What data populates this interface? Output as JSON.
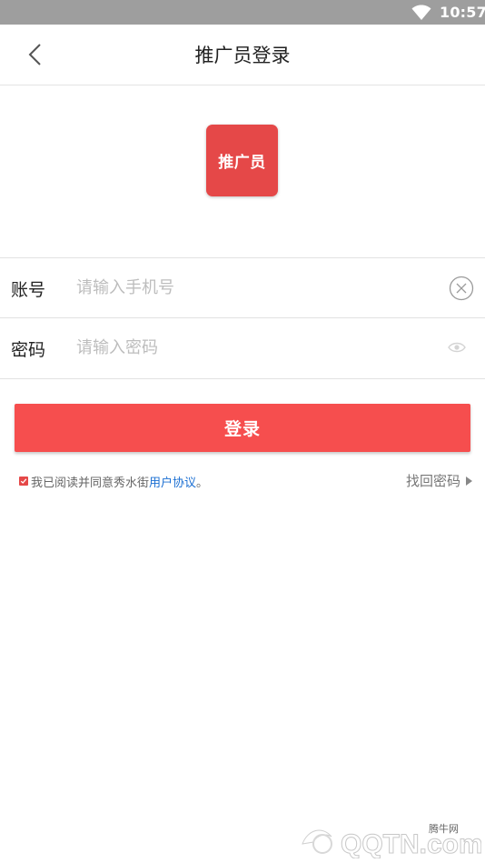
{
  "status_bar": {
    "time": "10:57"
  },
  "header": {
    "title": "推广员登录"
  },
  "logo": {
    "label": "推广员",
    "color": "#e54848"
  },
  "form": {
    "account": {
      "label": "账号",
      "placeholder": "请输入手机号",
      "value": ""
    },
    "password": {
      "label": "密码",
      "placeholder": "请输入密码",
      "value": ""
    }
  },
  "login_button": {
    "label": "登录",
    "color": "#f64e4e"
  },
  "agreement": {
    "text": "我已阅读并同意秀水街",
    "link": "用户协议",
    "suffix": "。",
    "checked": true,
    "link_color": "#1b6fd2"
  },
  "forgot_password": {
    "label": "找回密码"
  },
  "watermark": {
    "site": "腾牛网",
    "brand": "QQTN.com"
  }
}
